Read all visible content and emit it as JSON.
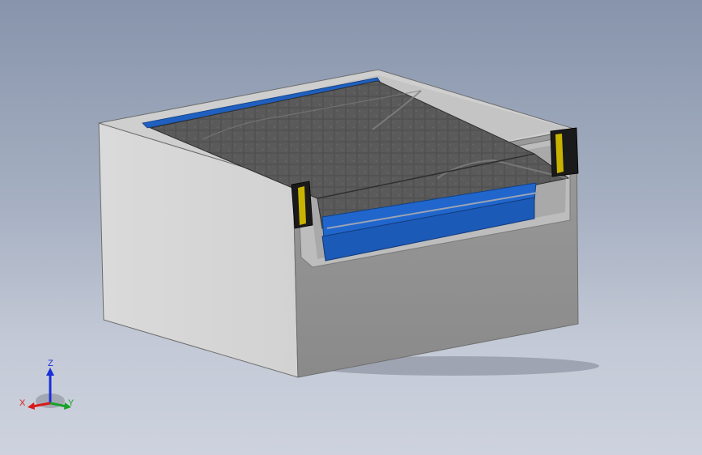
{
  "viewport": {
    "background_top": "#8794ab",
    "background_bottom": "#cdd2de"
  },
  "model": {
    "parts": [
      "concrete-pit",
      "dock-leveler-deck",
      "blue-frame",
      "lip-bar",
      "bumper-pad-left",
      "bumper-pad-right"
    ],
    "colors": {
      "concrete_light": "#d9d9d9",
      "concrete_mid": "#b5b5b5",
      "concrete_dark": "#8e8e8e",
      "deck": "#5b5b5b",
      "frame_blue": "#1f5fbf",
      "bumper_black": "#1a1a1a",
      "bumper_yellow": "#c8b400"
    }
  },
  "triad": {
    "z_label": "Z",
    "x_label": "X",
    "y_label": "Y",
    "z_color": "#1a2fd8",
    "x_color": "#d81a1a",
    "y_color": "#1aa12a"
  }
}
